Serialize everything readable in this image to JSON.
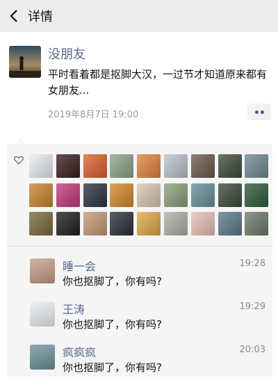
{
  "nav": {
    "title": "详情"
  },
  "post": {
    "author": "没朋友",
    "content": "平时看着都是抠脚大汉，一过节才知道原来都有女朋友...",
    "time": "2019年8月7日 19:00"
  },
  "colors": {
    "link": "#5a6a8e",
    "likes_bg": "#f5f5f5",
    "nav_bg": "#ededed"
  },
  "likes": {
    "icon": "heart-icon",
    "avatars": [
      "#e9eef2",
      "#3a1e1e",
      "#d8632c",
      "#8fa38a",
      "#e0843d",
      "#b8c4cc",
      "#6b5a4e",
      "#3e4c3a",
      "#6e8a92",
      "#c9852f",
      "#c23a7a",
      "#2a3440",
      "#d48a2a",
      "#d8c8b0",
      "#8ba07a",
      "#6a8f9a",
      "#3a4a3a",
      "#2e5a3a",
      "#7a6a3a",
      "#1e1e1e",
      "#c49a78",
      "#2a2f3a",
      "#e3a84a",
      "#b0b0a8",
      "#e8c2b8",
      "#5a7a8e",
      "#6e7a6a"
    ]
  },
  "comments": [
    {
      "name": "睡一会",
      "time": "19:28",
      "text": "你也抠脚了，你有吗?",
      "avatar": "#c49a84"
    },
    {
      "name": "王涛",
      "time": "19:29",
      "text": "你也抠脚了，你有吗?",
      "avatar": "#e9eef2"
    },
    {
      "name": "疯疯疯",
      "time": "20:03",
      "text": "你也抠脚了，你有吗?",
      "avatar": "#6a8f9a"
    }
  ]
}
